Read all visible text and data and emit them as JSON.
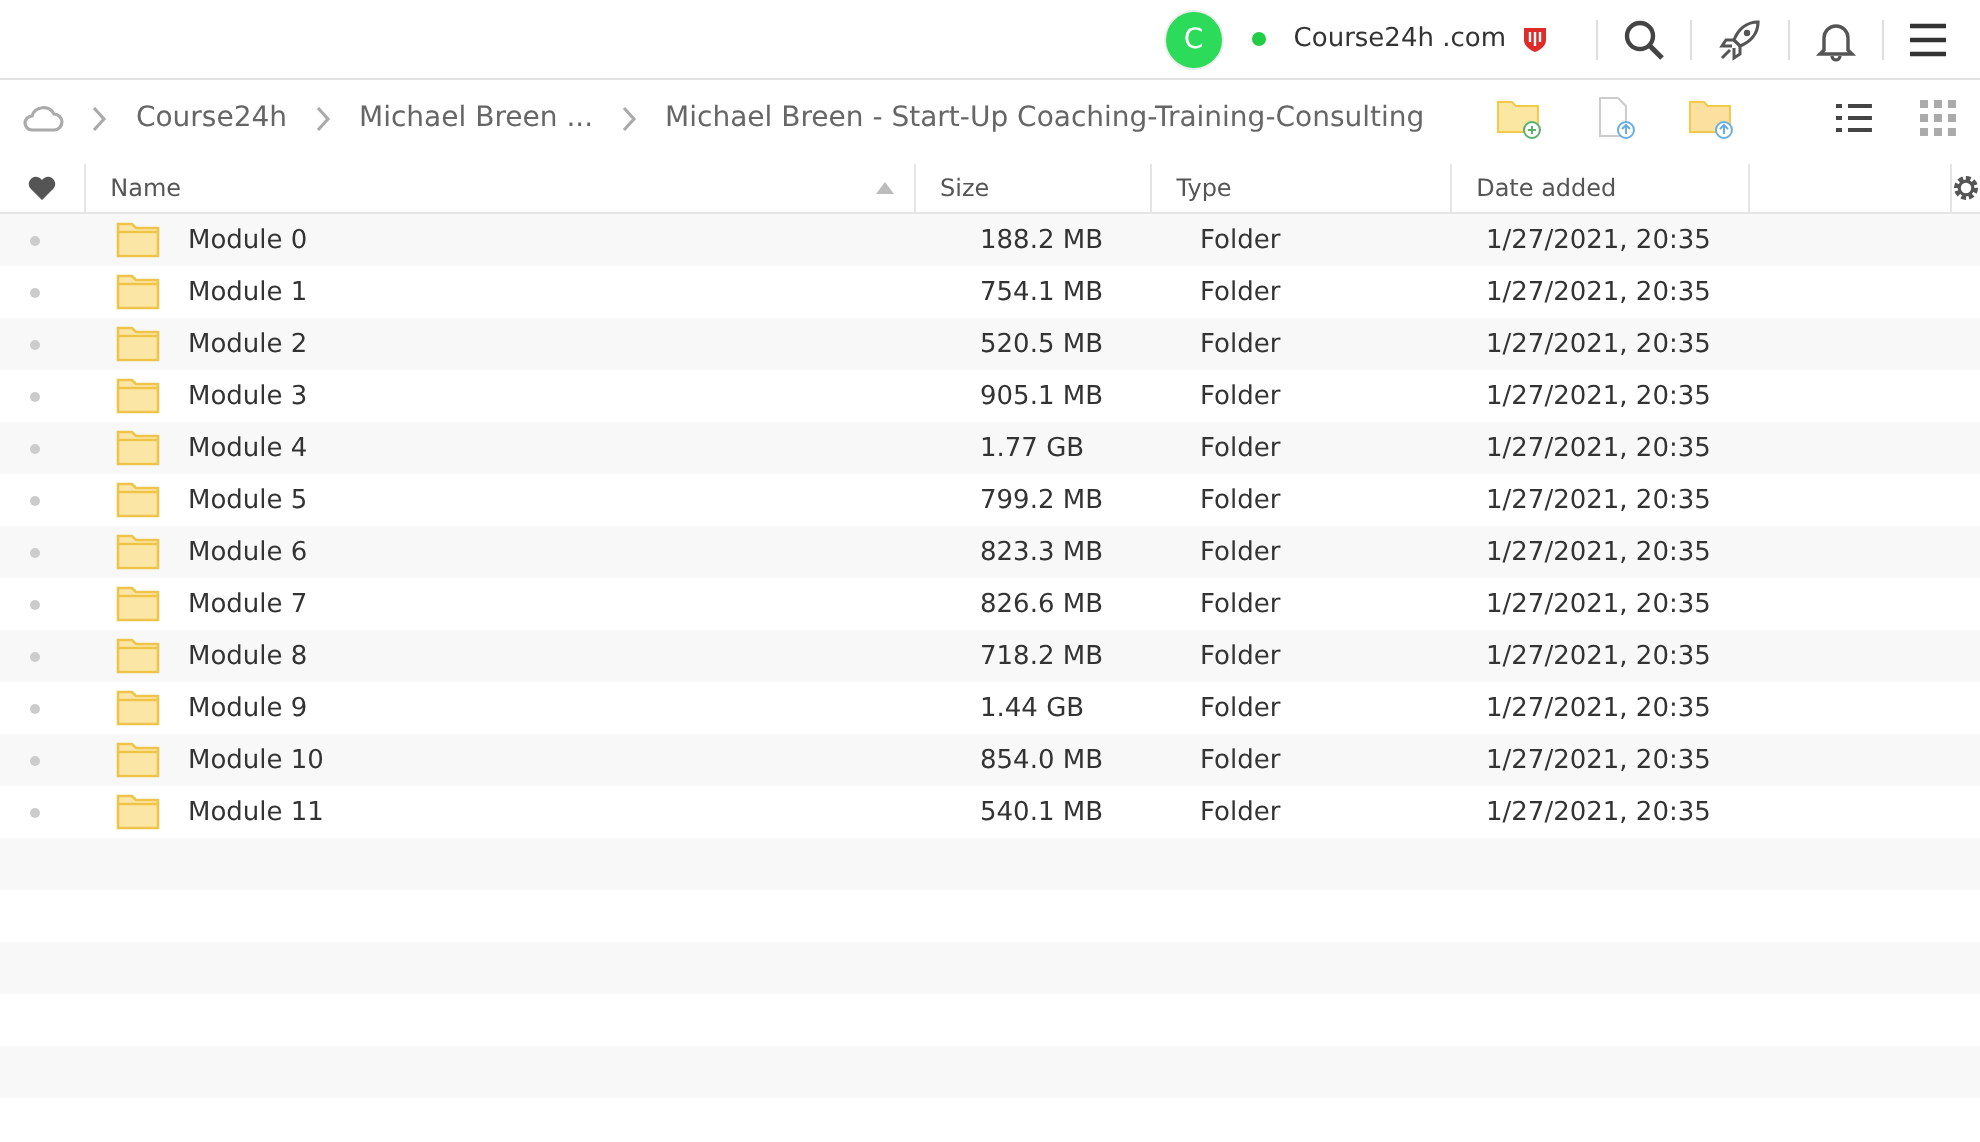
{
  "account": {
    "initial": "C",
    "site": "Course24h .com",
    "online": true
  },
  "breadcrumb": [
    "Course24h",
    "Michael Breen ...",
    "Michael Breen - Start-Up Coaching-Training-Consulting"
  ],
  "columns": [
    "Name",
    "Size",
    "Type",
    "Date added"
  ],
  "rows": [
    {
      "name": "Module 0",
      "size": "188.2 MB",
      "type": "Folder",
      "date": "1/27/2021, 20:35"
    },
    {
      "name": "Module 1",
      "size": "754.1 MB",
      "type": "Folder",
      "date": "1/27/2021, 20:35"
    },
    {
      "name": "Module 2",
      "size": "520.5 MB",
      "type": "Folder",
      "date": "1/27/2021, 20:35"
    },
    {
      "name": "Module 3",
      "size": "905.1 MB",
      "type": "Folder",
      "date": "1/27/2021, 20:35"
    },
    {
      "name": "Module 4",
      "size": "1.77 GB",
      "type": "Folder",
      "date": "1/27/2021, 20:35"
    },
    {
      "name": "Module 5",
      "size": "799.2 MB",
      "type": "Folder",
      "date": "1/27/2021, 20:35"
    },
    {
      "name": "Module 6",
      "size": "823.3 MB",
      "type": "Folder",
      "date": "1/27/2021, 20:35"
    },
    {
      "name": "Module 7",
      "size": "826.6 MB",
      "type": "Folder",
      "date": "1/27/2021, 20:35"
    },
    {
      "name": "Module 8",
      "size": "718.2 MB",
      "type": "Folder",
      "date": "1/27/2021, 20:35"
    },
    {
      "name": "Module 9",
      "size": "1.44 GB",
      "type": "Folder",
      "date": "1/27/2021, 20:35"
    },
    {
      "name": "Module 10",
      "size": "854.0 MB",
      "type": "Folder",
      "date": "1/27/2021, 20:35"
    },
    {
      "name": "Module 11",
      "size": "540.1 MB",
      "type": "Folder",
      "date": "1/27/2021, 20:35"
    }
  ]
}
